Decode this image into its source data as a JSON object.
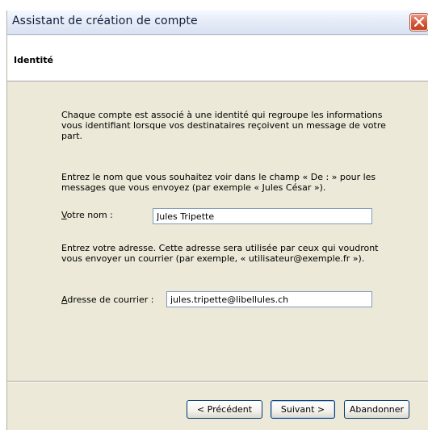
{
  "window": {
    "title": "Assistant de création de compte",
    "close_icon": "close-icon"
  },
  "header": {
    "page_title": "Identité"
  },
  "content": {
    "intro": "Chaque compte est associé à une identité qui regroupe les informations vous identifiant lorsque vos destinataires reçoivent un message de votre part.",
    "name_instructions": "Entrez le nom que vous souhaitez voir dans le champ « De : » pour les messages que vous envoyez (par exemple « Jules César »).",
    "name_label_accel": "V",
    "name_label_rest": "otre nom :",
    "name_value": "Jules Tripette",
    "email_instructions": "Entrez votre adresse. Cette adresse sera utilisée par ceux qui voudront vous envoyer un courrier (par exemple, « utilisateur@exemple.fr »).",
    "email_label_accel": "A",
    "email_label_rest": "dresse de courrier :",
    "email_value": "jules.tripette@libellules.ch"
  },
  "buttons": {
    "previous": "< Précédent",
    "next": "Suivant >",
    "cancel": "Abandonner"
  }
}
